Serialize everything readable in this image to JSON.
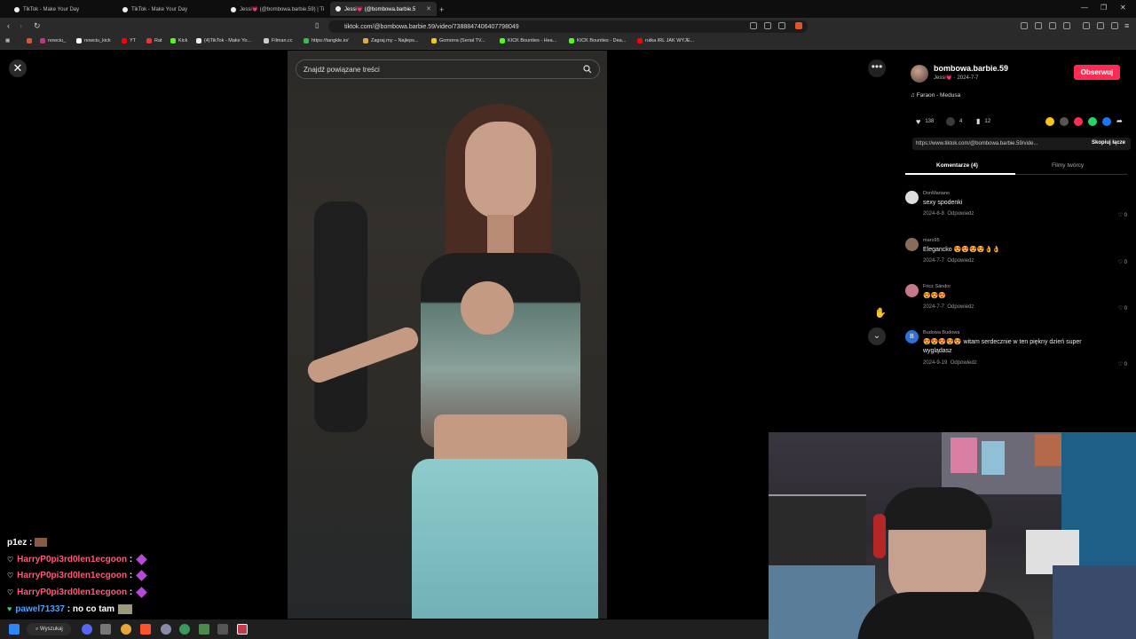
{
  "browser": {
    "tabs": [
      {
        "label": "TikTok - Make Your Day"
      },
      {
        "label": "TikTok - Make Your Day"
      },
      {
        "label": "Jessi💗 (@bombowa.barbie.59) | Ti"
      },
      {
        "label": "Jessi💗 (@bombowa.barbie.5"
      }
    ],
    "url": "tiktok.com/@bombowa.barbie.59/video/7388847406407798049",
    "bookmarks": [
      "nowciu_",
      "nowciu_kick",
      "YT",
      "Rat",
      "Kick",
      "(4)TikTok - Make Yo...",
      "Filman.cc",
      "https://tangkle.io/",
      "Zagraj.my – Najleps...",
      "Gomorra (Serial TV...",
      "KICK Bounties - Hea...",
      "KICK Bounties - Dea...",
      "rutka IRL JAK WYJE..."
    ]
  },
  "viewer": {
    "search_placeholder": "Znajdź powiązane treści",
    "close_icon": "close-icon",
    "more_icon": "more-icon",
    "down_icon": "chevron-down-icon"
  },
  "panel": {
    "username": "bombowa.barbie.59",
    "subline": "Jessi💗 · 2024-7-7",
    "follow_label": "Obserwuj",
    "music": "Faraon - Medusa",
    "likes": "138",
    "comments_count": "4",
    "saves": "12",
    "share_url": "https://www.tiktok.com/@bombowa.barbie.59/vide...",
    "copy_label": "Skopiuj łącze",
    "tab_comments": "Komentarze (4)",
    "tab_videos": "Filmy twórcy",
    "comments": [
      {
        "name": "DonMariano",
        "text": "sexy spodenki",
        "date": "2024-8-8",
        "reply": "Odpowiedz",
        "likes": "0"
      },
      {
        "name": "maro95",
        "text": "Elegancko 😍😍😍😍👌👌",
        "date": "2024-7-7",
        "reply": "Odpowiedz",
        "likes": "0"
      },
      {
        "name": "Fricz Sändor",
        "text": "😍😍😍",
        "date": "2024-7-7",
        "reply": "Odpowiedz",
        "likes": "0"
      },
      {
        "name": "Budowa Budowa",
        "text": "😍😍😍😍😍 witam serdecznie w ten piękny dzień super wyglądasz",
        "date": "2024-9-19",
        "reply": "Odpowiedz",
        "likes": "0",
        "initial": "B"
      }
    ]
  },
  "chat": [
    {
      "user": "p1ez",
      "message": "",
      "color": "#ffffff"
    },
    {
      "user": "HarryP0pi3rd0len1ecgoon",
      "message": "",
      "color": "#ff5a7a"
    },
    {
      "user": "HarryP0pi3rd0len1ecgoon",
      "message": "",
      "color": "#ff5a7a"
    },
    {
      "user": "HarryP0pi3rd0len1ecgoon",
      "message": "",
      "color": "#ff5a7a"
    },
    {
      "user": "pawel71337",
      "message": "no co tam",
      "color": "#4aa3ff"
    }
  ],
  "taskbar": {
    "search_label": "Wyszukaj"
  }
}
